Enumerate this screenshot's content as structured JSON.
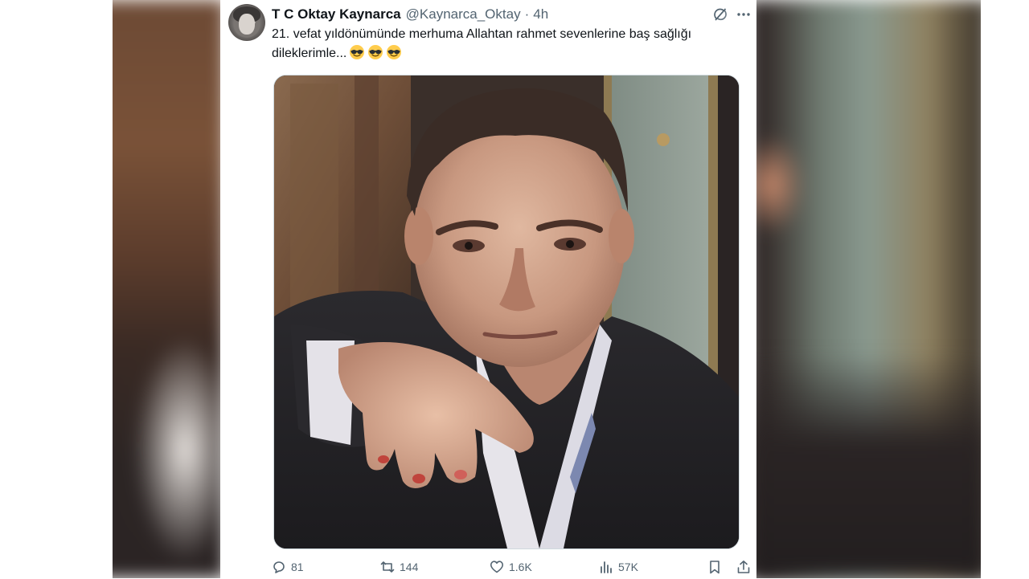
{
  "tweet": {
    "display_name": "T C Oktay Kaynarca",
    "handle": "@Kaynarca_Oktay",
    "separator": "·",
    "time": "4h",
    "text_line1": "21. vefat yıldönümünde  merhuma Allahtan rahmet sevenlerine baş sağlığı",
    "text_line2": "dileklerimle...",
    "emojis": [
      "smiling-face-with-sunglasses",
      "smiling-face-with-sunglasses",
      "smiling-face-with-sunglasses"
    ]
  },
  "actions": {
    "replies": "81",
    "reposts": "144",
    "likes": "1.6K",
    "views": "57K"
  },
  "icons": {
    "reply": "reply-icon",
    "repost": "repost-icon",
    "like": "heart-icon",
    "views": "views-icon",
    "bookmark": "bookmark-icon",
    "share": "share-icon",
    "grok": "grok-icon",
    "more": "more-icon"
  },
  "colors": {
    "text_primary": "#0f1419",
    "text_secondary": "#536471",
    "card_background": "#ffffff"
  }
}
